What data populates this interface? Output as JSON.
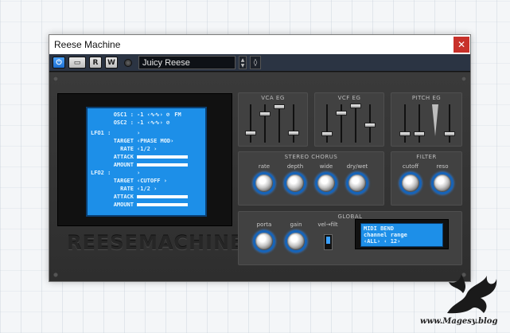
{
  "window": {
    "title": "Reese Machine",
    "close": "✕"
  },
  "toolbar": {
    "power_icon": "power-icon",
    "r_label": "R",
    "w_label": "W",
    "preset_name": "Juicy Reese"
  },
  "lcd": {
    "osc1": "OSC1 :",
    "osc1_val": "-1 ‹∿∿› ⊘",
    "osc2": "OSC2 :",
    "osc2_val": "-1 ‹∿∿› ⊘",
    "fm": "FM",
    "lfo1": "LFO1 :",
    "lfo1_val": "›",
    "target1": "TARGET",
    "target1_val": "‹PHASE MOD›",
    "rate1": "RATE",
    "rate1_val": "‹1/2      ›",
    "attack1": "ATTACK",
    "amount1": "AMOUNT",
    "lfo2": "LFO2 :",
    "lfo2_val": "›",
    "target2": "TARGET",
    "target2_val": "‹CUTOFF     ›",
    "rate2": "RATE",
    "rate2_val": "‹1/2      ›",
    "attack2": "ATTACK",
    "amount2": "AMOUNT"
  },
  "brand": "REESEMACHINE",
  "sections": {
    "vca_eg": "VCA EG",
    "vcf_eg": "VCF EG",
    "pitch_eg": "PITCH EG",
    "stereo_chorus": "STEREO CHORUS",
    "filter": "FILTER",
    "global": "GLOBAL"
  },
  "knobs": {
    "rate": "rate",
    "depth": "depth",
    "wide": "wide",
    "drywet": "dry/wet",
    "cutoff": "cutoff",
    "reso": "reso",
    "porta": "porta",
    "gain": "gain",
    "velfilt": "vel→filt"
  },
  "midi": {
    "line1": "MIDI    BEND",
    "line2": "channel range",
    "line3": "‹ALL›   ‹ 12›"
  },
  "watermark": "www.Magesy.blog"
}
